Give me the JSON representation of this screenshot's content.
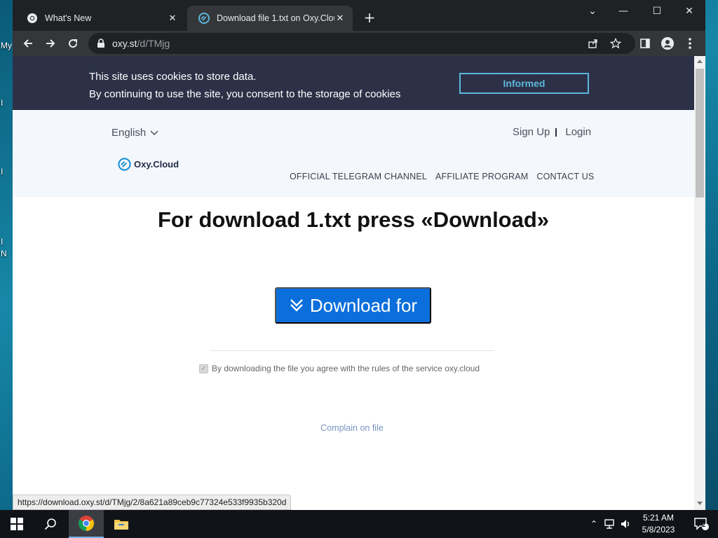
{
  "desktop": {
    "labels": [
      "My",
      "I",
      "I",
      "I",
      "N"
    ]
  },
  "tabs": [
    {
      "title": "What's New",
      "active": false
    },
    {
      "title": "Download file 1.txt on Oxy.Cloud",
      "active": true
    }
  ],
  "address": {
    "host": "oxy.st",
    "path": "/d/TMjg"
  },
  "cookie": {
    "line1": "This site uses cookies to store data.",
    "line2": "By continuing to use the site, you consent to the storage of cookies",
    "button": "Informed"
  },
  "header": {
    "language": "English",
    "signup": "Sign Up",
    "login": "Login",
    "logo_text": "Oxy.Cloud",
    "nav": [
      "OFFICIAL TELEGRAM CHANNEL",
      "AFFILIATE PROGRAM",
      "CONTACT US"
    ]
  },
  "main": {
    "headline_pre": "For download ",
    "filename": "1.txt",
    "headline_mid": " press ",
    "headline_action": "«Download»",
    "download_button": "Download for",
    "agree_text": "By downloading the file you agree with the rules of the service oxy.cloud",
    "complain": "Complain on file"
  },
  "status_url": "https://download.oxy.st/d/TMjg/2/8a621a89ceb9c77324e533f9935b320d",
  "taskbar": {
    "time": "5:21 AM",
    "date": "5/8/2023",
    "notifications": "2"
  },
  "colors": {
    "banner": "#2c3147",
    "accent": "#5db7dc",
    "download": "#0b6fdb",
    "header_bg": "#f4f7fb"
  }
}
